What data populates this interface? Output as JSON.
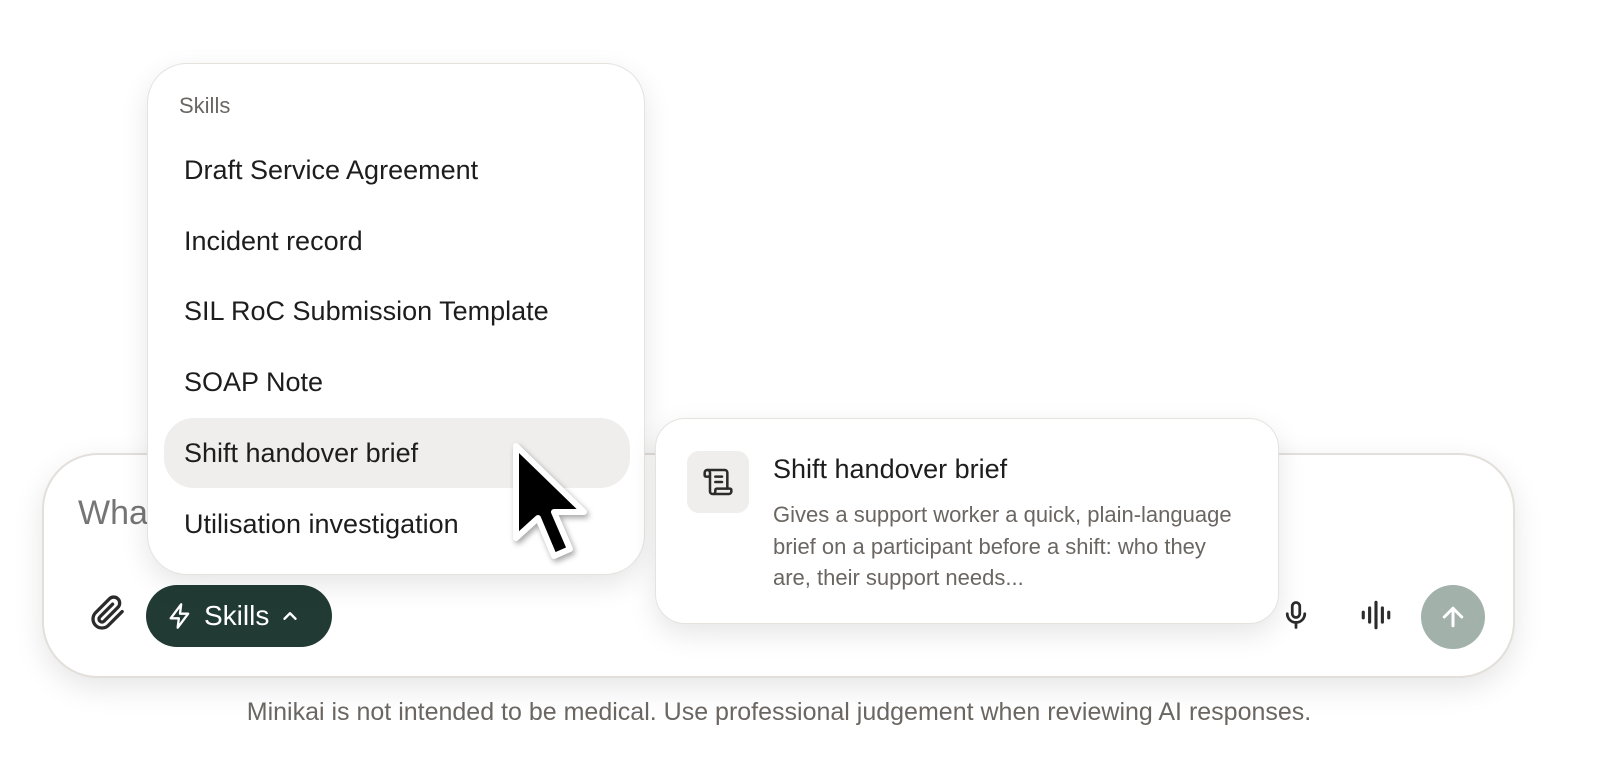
{
  "composer": {
    "placeholder": "What",
    "skills_button_label": "Skills"
  },
  "skills_menu": {
    "heading": "Skills",
    "items": [
      {
        "label": "Draft Service Agreement"
      },
      {
        "label": "Incident record"
      },
      {
        "label": "SIL RoC Submission Template"
      },
      {
        "label": "SOAP Note"
      },
      {
        "label": "Shift handover brief",
        "active": true
      },
      {
        "label": "Utilisation investigation"
      }
    ]
  },
  "detail_card": {
    "icon": "scroll-icon",
    "title": "Shift handover brief",
    "description": "Gives a support worker a quick, plain-language brief on a participant before a shift: who they are, their support needs..."
  },
  "disclaimer": "Minikai is not intended to be medical. Use professional judgement when reviewing AI responses.",
  "colors": {
    "skills_button_bg": "#213b34",
    "send_button_bg": "#a3b1ab",
    "active_item_bg": "#efeeec"
  }
}
